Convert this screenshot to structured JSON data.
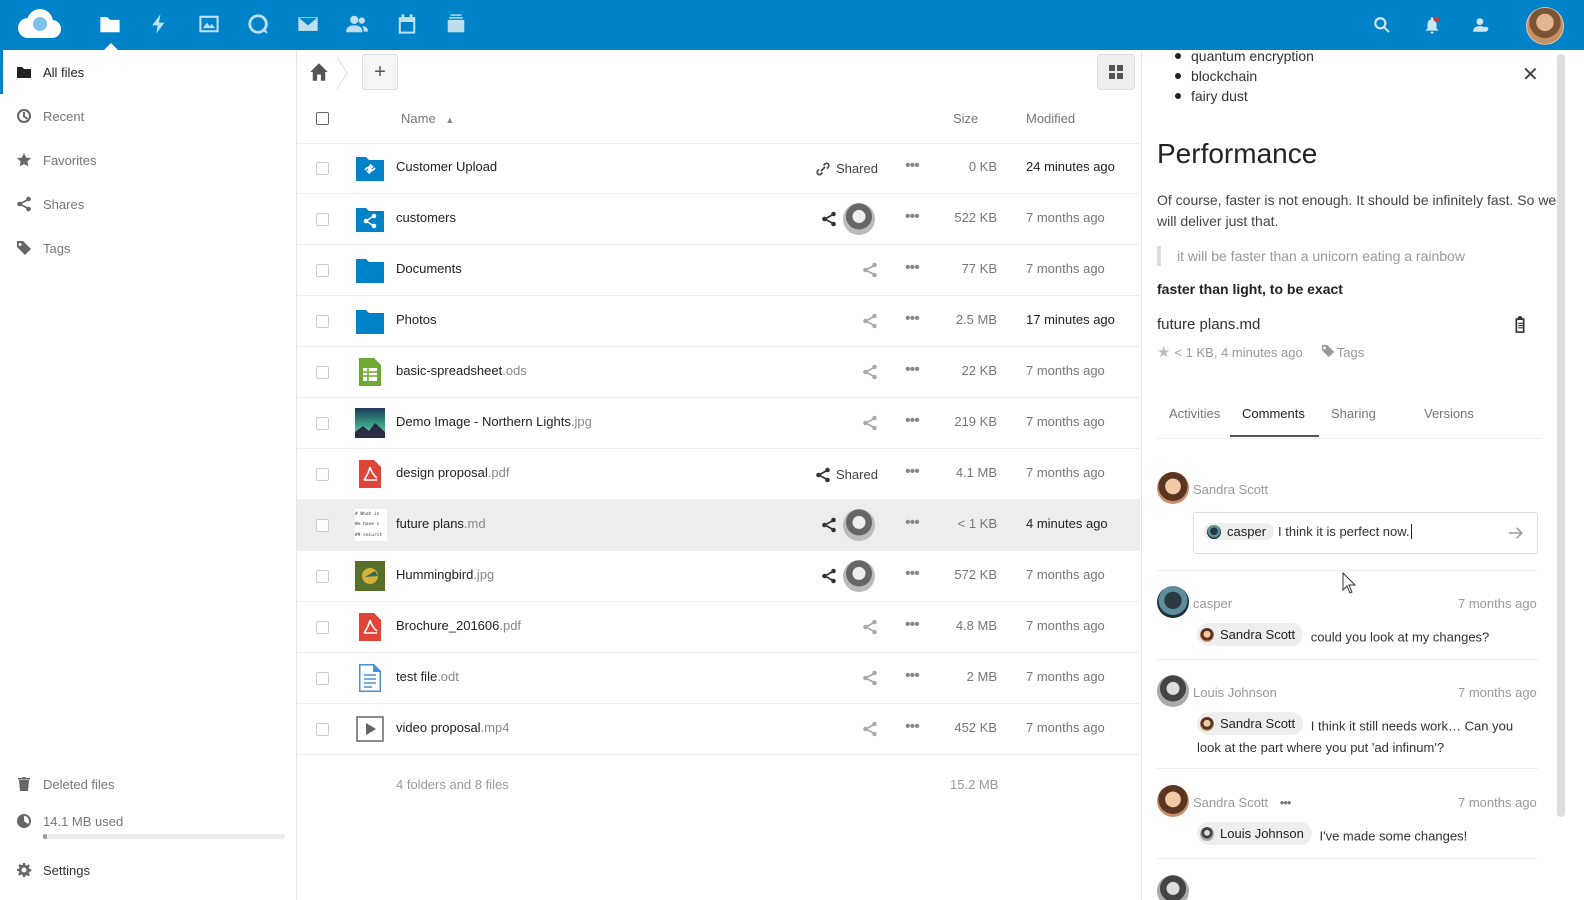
{
  "colors": {
    "accent": "#0082c9",
    "folder": "#0082c9",
    "spreadsheet": "#6ea934",
    "pdf": "#e0453a",
    "text_doc": "#4a90d9"
  },
  "topbar": {
    "apps": [
      "files-icon",
      "activity-icon",
      "gallery-icon",
      "talk-icon",
      "mail-icon",
      "contacts-icon",
      "calendar-icon",
      "deck-icon"
    ],
    "right_icons": [
      "search-icon",
      "notifications-icon",
      "contacts-menu-icon",
      "user-avatar"
    ]
  },
  "sidebar": {
    "items": [
      {
        "label": "All files",
        "icon": "folder-icon",
        "active": true
      },
      {
        "label": "Recent",
        "icon": "clock-icon"
      },
      {
        "label": "Favorites",
        "icon": "star-icon"
      },
      {
        "label": "Shares",
        "icon": "share-icon"
      },
      {
        "label": "Tags",
        "icon": "tag-icon"
      }
    ],
    "deleted": "Deleted files",
    "quota": "14.1 MB used",
    "settings": "Settings"
  },
  "files": {
    "header": {
      "name": "Name",
      "size": "Size",
      "modified": "Modified"
    },
    "rows": [
      {
        "name": "Customer Upload",
        "ext": "",
        "type": "folder-link",
        "share": "Shared",
        "size": "0 KB",
        "modified": "24 minutes ago",
        "recent": true
      },
      {
        "name": "customers",
        "ext": "",
        "type": "folder-shared",
        "share": "avatar",
        "size": "522 KB",
        "modified": "7 months ago"
      },
      {
        "name": "Documents",
        "ext": "",
        "type": "folder",
        "share": "",
        "size": "77 KB",
        "modified": "7 months ago"
      },
      {
        "name": "Photos",
        "ext": "",
        "type": "folder",
        "share": "",
        "size": "2.5 MB",
        "modified": "17 minutes ago",
        "recent": true
      },
      {
        "name": "basic-spreadsheet",
        "ext": ".ods",
        "type": "spreadsheet",
        "share": "",
        "size": "22 KB",
        "modified": "7 months ago"
      },
      {
        "name": "Demo Image - Northern Lights",
        "ext": ".jpg",
        "type": "image-aurora",
        "share": "",
        "size": "219 KB",
        "modified": "7 months ago"
      },
      {
        "name": "design proposal",
        "ext": ".pdf",
        "type": "pdf",
        "share": "Shared",
        "size": "4.1 MB",
        "modified": "7 months ago"
      },
      {
        "name": "future plans",
        "ext": ".md",
        "type": "markdown",
        "share": "avatar",
        "size": "< 1 KB",
        "modified": "4 minutes ago",
        "recent": true,
        "highlight": true
      },
      {
        "name": "Hummingbird",
        "ext": ".jpg",
        "type": "image-bird",
        "share": "avatar",
        "size": "572 KB",
        "modified": "7 months ago"
      },
      {
        "name": "Brochure_201606",
        "ext": ".pdf",
        "type": "pdf",
        "share": "",
        "size": "4.8 MB",
        "modified": "7 months ago"
      },
      {
        "name": "test file",
        "ext": ".odt",
        "type": "text-doc",
        "share": "",
        "size": "2 MB",
        "modified": "7 months ago"
      },
      {
        "name": "video proposal",
        "ext": ".mp4",
        "type": "video",
        "share": "",
        "size": "452 KB",
        "modified": "7 months ago"
      }
    ],
    "summary": "4 folders and 8 files",
    "summary_size": "15.2 MB"
  },
  "preview": {
    "bullets": [
      "quantum encryption",
      "blockchain",
      "fairy dust"
    ],
    "heading": "Performance",
    "paragraph": "Of course, faster is not enough. It should be infinitely fast. So we will deliver just that.",
    "quote": "it will be faster than a unicorn eating a rainbow",
    "bold": "faster than light, to be exact",
    "filename": "future plans.md",
    "meta": "< 1 KB, 4 minutes ago",
    "tags_label": "Tags"
  },
  "tabs": [
    "Activities",
    "Comments",
    "Sharing",
    "Versions"
  ],
  "comments": {
    "new_author": "Sandra Scott",
    "new_mention": "casper",
    "new_text": "I think it is perfect now.",
    "items": [
      {
        "author": "casper",
        "date": "7 months ago",
        "mention": "Sandra Scott",
        "text": "could you look at my changes?"
      },
      {
        "author": "Louis Johnson",
        "date": "7 months ago",
        "mention": "Sandra Scott",
        "text": "I think it still needs work… Can you look at the part where you put 'ad infinum'?"
      },
      {
        "author": "Sandra Scott",
        "date": "7 months ago",
        "mention": "Louis Johnson",
        "text": "I've made some changes!"
      }
    ]
  }
}
